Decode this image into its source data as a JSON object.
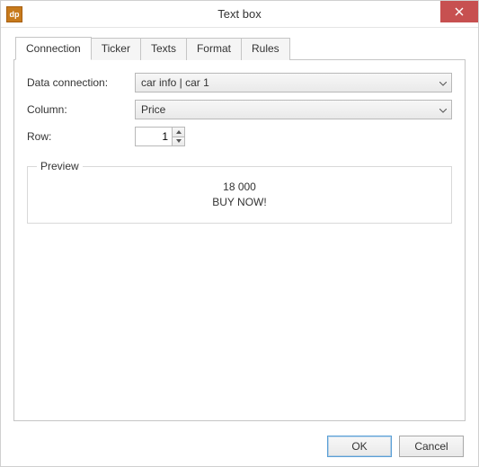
{
  "window": {
    "app_icon_text": "dp",
    "title": "Text box"
  },
  "tabs": [
    {
      "label": "Connection",
      "active": true
    },
    {
      "label": "Ticker",
      "active": false
    },
    {
      "label": "Texts",
      "active": false
    },
    {
      "label": "Format",
      "active": false
    },
    {
      "label": "Rules",
      "active": false
    }
  ],
  "form": {
    "data_connection_label": "Data connection:",
    "data_connection_value": "car info | car 1",
    "column_label": "Column:",
    "column_value": "Price",
    "row_label": "Row:",
    "row_value": "1"
  },
  "preview": {
    "legend": "Preview",
    "text": "18 000\nBUY NOW!"
  },
  "buttons": {
    "ok": "OK",
    "cancel": "Cancel"
  }
}
